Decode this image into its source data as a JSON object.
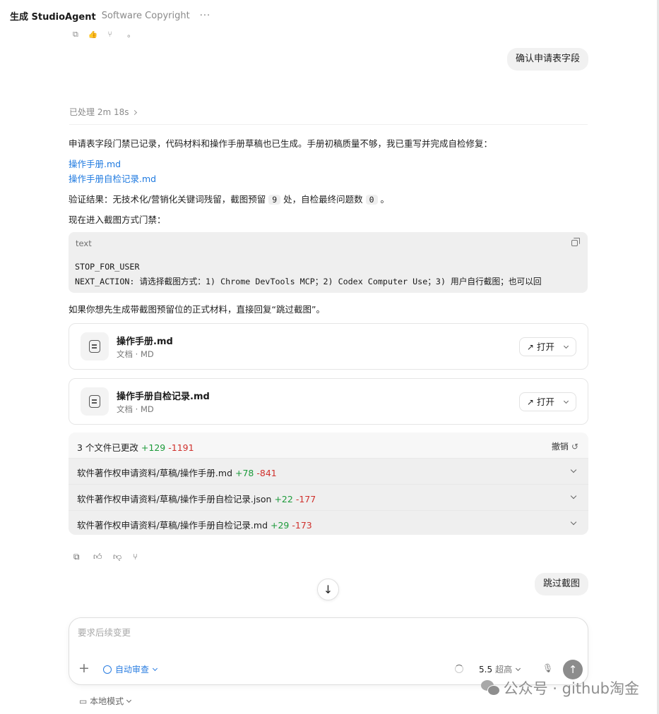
{
  "header": {
    "app_title": "生成 StudioAgent",
    "project": "Software Copyright",
    "more": "···"
  },
  "top_partial_text": "。",
  "messages": {
    "user_1": "确认申请表字段",
    "processed": "已处理 2m 18s",
    "para_1": "申请表字段门禁已记录，代码材料和操作手册草稿也已生成。手册初稿质量不够，我已重写并完成自检修复：",
    "link_1": "操作手册.md",
    "link_2": "操作手册自检记录.md",
    "verify_a": "验证结果：无技术化/营销化关键词残留，截图预留",
    "verify_num1": "9",
    "verify_b": "处，自检最终问题数",
    "verify_num2": "0",
    "verify_c": "。",
    "para_3": "现在进入截图方式门禁：",
    "code_lang": "text",
    "code_line_1": "STOP_FOR_USER",
    "code_line_2": "NEXT_ACTION: 请选择截图方式：1) Chrome DevTools MCP；2) Codex Computer Use；3) 用户自行截图；也可以回",
    "para_4": "如果你想先生成带截图预留位的正式材料，直接回复“跳过截图”。",
    "user_2": "跳过截图"
  },
  "files": [
    {
      "name": "操作手册.md",
      "meta": "文档 · MD",
      "open_label": "打开"
    },
    {
      "name": "操作手册自检记录.md",
      "meta": "文档 · MD",
      "open_label": "打开"
    }
  ],
  "changes": {
    "summary": "3 个文件已更改",
    "added": "+129",
    "removed": "-1191",
    "undo_label": "撤销",
    "rows": [
      {
        "path": "软件著作权申请资料/草稿/操作手册.md",
        "added": "+78",
        "removed": "-841"
      },
      {
        "path": "软件著作权申请资料/草稿/操作手册自检记录.json",
        "added": "+22",
        "removed": "-177"
      },
      {
        "path": "软件著作权申请资料/草稿/操作手册自检记录.md",
        "added": "+29",
        "removed": "-173"
      }
    ]
  },
  "composer": {
    "placeholder": "要求后续变更",
    "auto_review": "自动审查",
    "model": "5.5",
    "level": "超高"
  },
  "footer": {
    "local_mode": "本地模式",
    "watermark": "公众号 · github淘金"
  },
  "colors": {
    "link": "#1f7ae0",
    "added": "#1c9a3a",
    "removed": "#d0312d",
    "accent": "#2a7de1"
  }
}
